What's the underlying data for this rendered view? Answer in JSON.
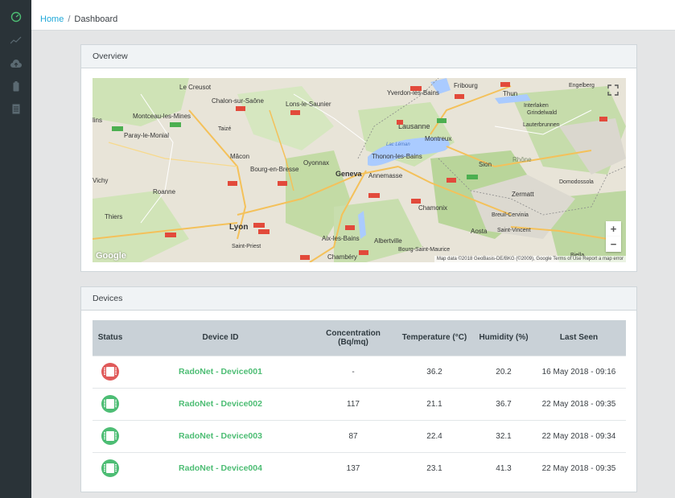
{
  "breadcrumb": {
    "home": "Home",
    "separator": "/",
    "current": "Dashboard"
  },
  "sidebar": {
    "items": [
      {
        "icon": "speedometer-icon",
        "active": true
      },
      {
        "icon": "chart-line-icon",
        "active": false
      },
      {
        "icon": "cloud-upload-icon",
        "active": false
      },
      {
        "icon": "battery-icon",
        "active": false
      },
      {
        "icon": "document-icon",
        "active": false
      }
    ]
  },
  "overview": {
    "title": "Overview",
    "map": {
      "labels": [
        {
          "text": "Le Creusot"
        },
        {
          "text": "Chalon-sur-Saône"
        },
        {
          "text": "Lons-le-Saunier"
        },
        {
          "text": "Montceau-les-Mines"
        },
        {
          "text": "Paray-le-Monial"
        },
        {
          "text": "Taizé"
        },
        {
          "text": "Mâcon"
        },
        {
          "text": "Bourg-en-Bresse"
        },
        {
          "text": "Oyonnax"
        },
        {
          "text": "Roanne"
        },
        {
          "text": "Thiers"
        },
        {
          "text": "Lyon"
        },
        {
          "text": "Saint-Priest"
        },
        {
          "text": "Geneva"
        },
        {
          "text": "Annemasse"
        },
        {
          "text": "Thonon-les-Bains"
        },
        {
          "text": "Lausanne"
        },
        {
          "text": "Montreux"
        },
        {
          "text": "Yverdon-les-Bains"
        },
        {
          "text": "Fribourg"
        },
        {
          "text": "Thun"
        },
        {
          "text": "Interlaken"
        },
        {
          "text": "Grindelwald"
        },
        {
          "text": "Lauterbrunnen"
        },
        {
          "text": "Engelberg"
        },
        {
          "text": "Sion"
        },
        {
          "text": "Chamonix"
        },
        {
          "text": "Zermatt"
        },
        {
          "text": "Breuil-Cervinia"
        },
        {
          "text": "Aosta"
        },
        {
          "text": "Saint-Vincent"
        },
        {
          "text": "Aix-les-Bains"
        },
        {
          "text": "Albertville"
        },
        {
          "text": "Chambéry"
        },
        {
          "text": "Bourg-Saint-Maurice"
        },
        {
          "text": "Domodossola"
        },
        {
          "text": "Biella"
        },
        {
          "text": "Rhône"
        },
        {
          "text": "Lac Léman"
        },
        {
          "text": "lins"
        },
        {
          "text": "Vichy"
        }
      ],
      "attribution": "Map data ©2018 GeoBasis-DE/BKG (©2009), Google   Terms of Use   Report a map error",
      "logo": "Google",
      "zoom_in": "+",
      "zoom_out": "−"
    }
  },
  "devices": {
    "title": "Devices",
    "columns": [
      "Status",
      "Device ID",
      "Concentration\n(Bq/mq)",
      "Temperature (°C)",
      "Humidity (%)",
      "Last Seen"
    ],
    "rows": [
      {
        "status": "offline",
        "status_color": "#e05a5a",
        "device_id": "RadoNet - Device001",
        "concentration": "-",
        "temperature": "36.2",
        "humidity": "20.2",
        "last_seen": "16 May 2018 - 09:16"
      },
      {
        "status": "online",
        "status_color": "#4dbd74",
        "device_id": "RadoNet - Device002",
        "concentration": "117",
        "temperature": "21.1",
        "humidity": "36.7",
        "last_seen": "22 May 2018 - 09:35"
      },
      {
        "status": "online",
        "status_color": "#4dbd74",
        "device_id": "RadoNet - Device003",
        "concentration": "87",
        "temperature": "22.4",
        "humidity": "32.1",
        "last_seen": "22 May 2018 - 09:34"
      },
      {
        "status": "online",
        "status_color": "#4dbd74",
        "device_id": "RadoNet - Device004",
        "concentration": "137",
        "temperature": "23.1",
        "humidity": "41.3",
        "last_seen": "22 May 2018 - 09:35"
      }
    ]
  },
  "colors": {
    "accent": "#20a8d8",
    "success": "#4dbd74",
    "danger": "#e05a5a",
    "sidebar": "#2a3338"
  }
}
